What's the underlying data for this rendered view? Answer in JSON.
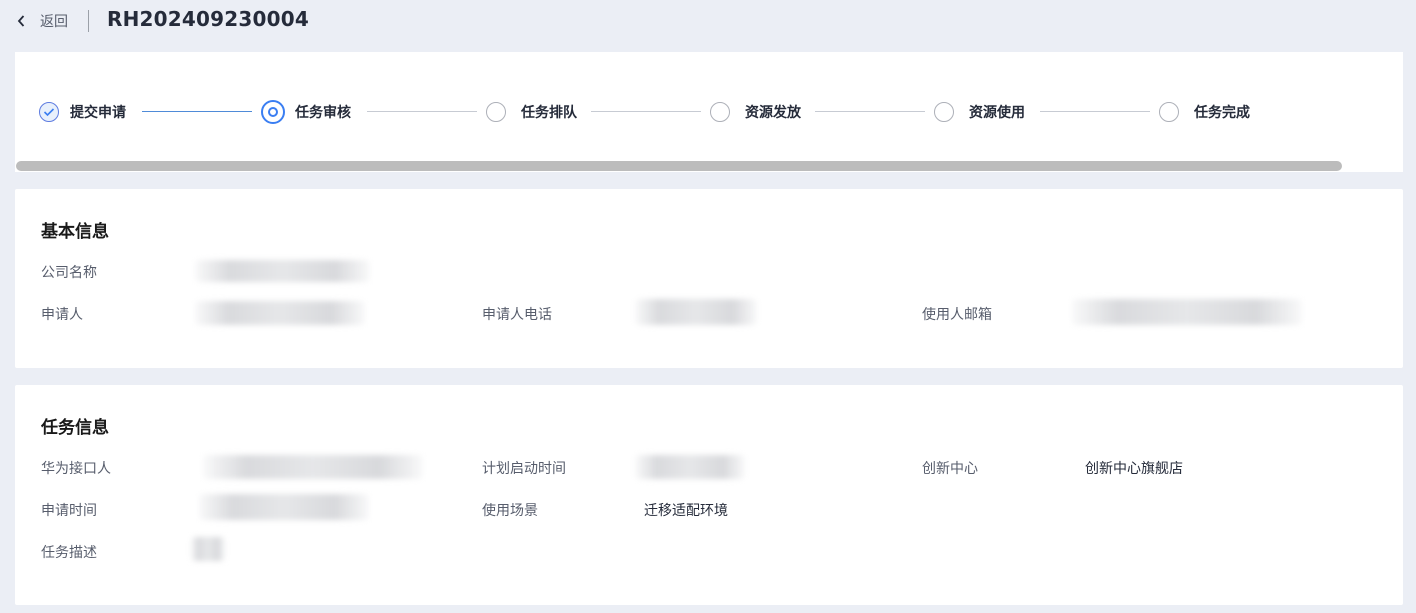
{
  "header": {
    "back_label": "返回",
    "order_id": "RH202409230004"
  },
  "steps": [
    {
      "label": "提交申请",
      "status": "done"
    },
    {
      "label": "任务审核",
      "status": "active"
    },
    {
      "label": "任务排队",
      "status": "pending"
    },
    {
      "label": "资源发放",
      "status": "pending"
    },
    {
      "label": "资源使用",
      "status": "pending"
    },
    {
      "label": "任务完成",
      "status": "pending"
    }
  ],
  "basic_info": {
    "title": "基本信息",
    "company_label": "公司名称",
    "applicant_label": "申请人",
    "applicant_phone_label": "申请人电话",
    "user_email_label": "使用人邮箱"
  },
  "task_info": {
    "title": "任务信息",
    "huawei_contact_label": "华为接口人",
    "planned_start_label": "计划启动时间",
    "innovation_center_label": "创新中心",
    "innovation_center_value": "创新中心旗舰店",
    "apply_time_label": "申请时间",
    "usage_scenario_label": "使用场景",
    "usage_scenario_value": "迁移适配环境",
    "task_desc_label": "任务描述"
  },
  "colors": {
    "accent": "#3a7ef2",
    "page_bg": "#ebeef5",
    "card_bg": "#ffffff"
  }
}
